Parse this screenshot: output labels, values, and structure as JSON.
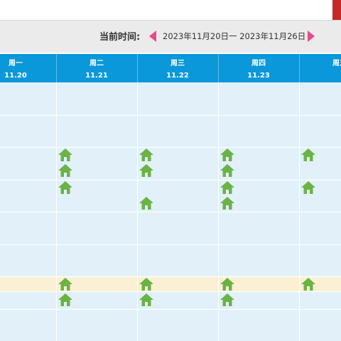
{
  "nav": {
    "label": "当前时间:",
    "range": "2023年11月20日一 2023年11月26日"
  },
  "days": [
    {
      "name": "周一",
      "date": "11.20"
    },
    {
      "name": "周二",
      "date": "11.21"
    },
    {
      "name": "周三",
      "date": "11.22"
    },
    {
      "name": "周四",
      "date": "11.23"
    },
    {
      "name": "周五",
      "date": ""
    }
  ],
  "colors": {
    "header_blue": "#0b98da",
    "grid_bg": "#e2f1f9",
    "highlight_row": "#fbf0d4",
    "arrow_pink": "#e64a87",
    "house_green": "#6ab344"
  },
  "icons": {
    "nav_prev": "arrow-left-icon",
    "nav_next": "arrow-right-icon",
    "marker": "house-icon"
  },
  "schedule": {
    "highlighted_row": 6,
    "markers": [
      {
        "day": 1,
        "row": 2,
        "slot": 0
      },
      {
        "day": 1,
        "row": 2,
        "slot": 1
      },
      {
        "day": 2,
        "row": 2,
        "slot": 0
      },
      {
        "day": 2,
        "row": 2,
        "slot": 1
      },
      {
        "day": 3,
        "row": 2,
        "slot": 0
      },
      {
        "day": 3,
        "row": 2,
        "slot": 1
      },
      {
        "day": 4,
        "row": 2,
        "slot": 0
      },
      {
        "day": 1,
        "row": 3,
        "slot": 0
      },
      {
        "day": 2,
        "row": 3,
        "slot": 1
      },
      {
        "day": 3,
        "row": 3,
        "slot": 0
      },
      {
        "day": 3,
        "row": 3,
        "slot": 1
      },
      {
        "day": 4,
        "row": 3,
        "slot": 0
      },
      {
        "day": 1,
        "row": 6,
        "slot": 0
      },
      {
        "day": 1,
        "row": 6,
        "slot": 1
      },
      {
        "day": 2,
        "row": 6,
        "slot": 0
      },
      {
        "day": 2,
        "row": 6,
        "slot": 1
      },
      {
        "day": 3,
        "row": 6,
        "slot": 0
      },
      {
        "day": 3,
        "row": 6,
        "slot": 1
      },
      {
        "day": 4,
        "row": 6,
        "slot": 0
      }
    ]
  }
}
